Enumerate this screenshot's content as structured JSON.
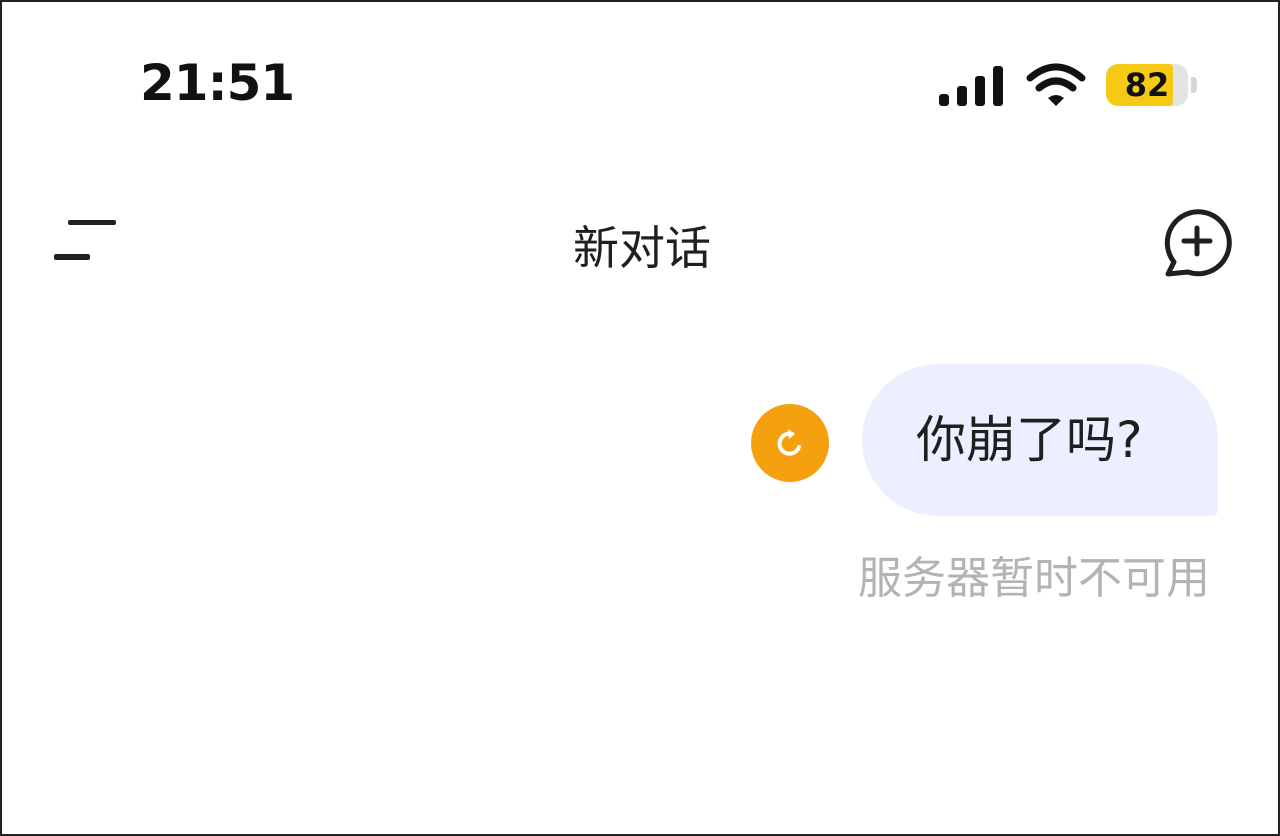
{
  "status_bar": {
    "time": "21:51",
    "battery_level": "82",
    "battery_fraction": 0.82,
    "icons": [
      "signal-icon",
      "wifi-icon",
      "battery-icon"
    ]
  },
  "header": {
    "title": "新对话",
    "menu_icon": "menu-icon",
    "new_chat_icon": "new-chat-icon"
  },
  "conversation": {
    "messages": [
      {
        "role": "user",
        "text": "你崩了吗?",
        "status": "服务器暂时不可用",
        "retry_icon": "retry-icon"
      }
    ]
  },
  "colors": {
    "accent": "#f5a00f",
    "bubble": "#ecefff",
    "battery": "#f6c915",
    "muted_text": "#b3b3b3"
  }
}
